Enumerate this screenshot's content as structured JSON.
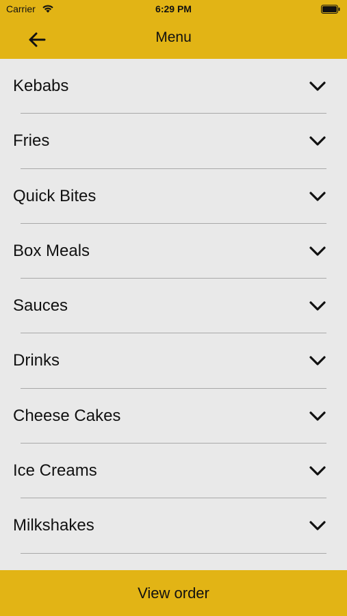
{
  "status_bar": {
    "carrier": "Carrier",
    "time": "6:29 PM",
    "wifi_icon": "wifi-icon",
    "battery_icon": "battery-icon"
  },
  "nav": {
    "back_icon": "arrow-left-icon",
    "title": "Menu"
  },
  "menu": {
    "items": [
      {
        "label": "Kebabs",
        "icon": "chevron-down-icon"
      },
      {
        "label": "Fries",
        "icon": "chevron-down-icon"
      },
      {
        "label": "Quick Bites",
        "icon": "chevron-down-icon"
      },
      {
        "label": "Box Meals",
        "icon": "chevron-down-icon"
      },
      {
        "label": "Sauces",
        "icon": "chevron-down-icon"
      },
      {
        "label": "Drinks",
        "icon": "chevron-down-icon"
      },
      {
        "label": "Cheese Cakes",
        "icon": "chevron-down-icon"
      },
      {
        "label": "Ice Creams",
        "icon": "chevron-down-icon"
      },
      {
        "label": "Milkshakes",
        "icon": "chevron-down-icon"
      }
    ]
  },
  "footer": {
    "button_label": "View order"
  },
  "colors": {
    "accent": "#e2b415",
    "background": "#e9e9e9",
    "divider": "#a8a8a8",
    "text": "#111111"
  }
}
